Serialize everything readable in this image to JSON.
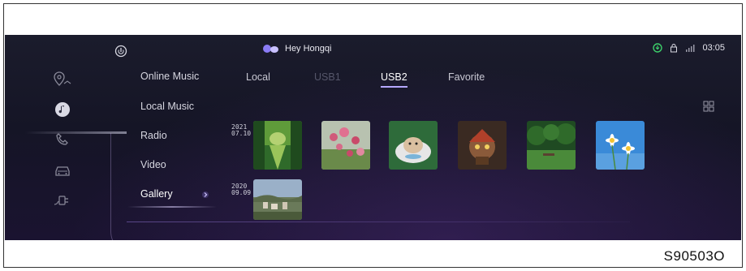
{
  "status_bar": {
    "assistant_label": "Hey Hongqi",
    "time": "03:05",
    "icons": [
      "power-icon",
      "assistant-icon",
      "download-icon",
      "lock-icon",
      "signal-icon"
    ]
  },
  "rail": {
    "items": [
      "navigation-icon",
      "music-icon",
      "phone-icon",
      "car-icon",
      "charging-icon"
    ],
    "active": "music-icon"
  },
  "menu": {
    "items": [
      "Online Music",
      "Local Music",
      "Radio",
      "Video",
      "Gallery"
    ],
    "active": "Gallery"
  },
  "tabs": {
    "items": [
      {
        "label": "Local",
        "state": "normal"
      },
      {
        "label": "USB1",
        "state": "disabled"
      },
      {
        "label": "USB2",
        "state": "active"
      },
      {
        "label": "Favorite",
        "state": "normal"
      }
    ]
  },
  "gallery": {
    "groups": [
      {
        "year": "2021",
        "day": "07.10",
        "photos": [
          "forest-path",
          "pink-flowers",
          "hamster-in-cup",
          "game-character",
          "green-park",
          "daisies-sky"
        ]
      },
      {
        "year": "2020",
        "day": "09.09",
        "photos": [
          "town-landscape"
        ]
      }
    ]
  },
  "figure_code": "S90503O",
  "colors": {
    "accent": "#b6a8ff",
    "screen_bg": "#17172a"
  }
}
